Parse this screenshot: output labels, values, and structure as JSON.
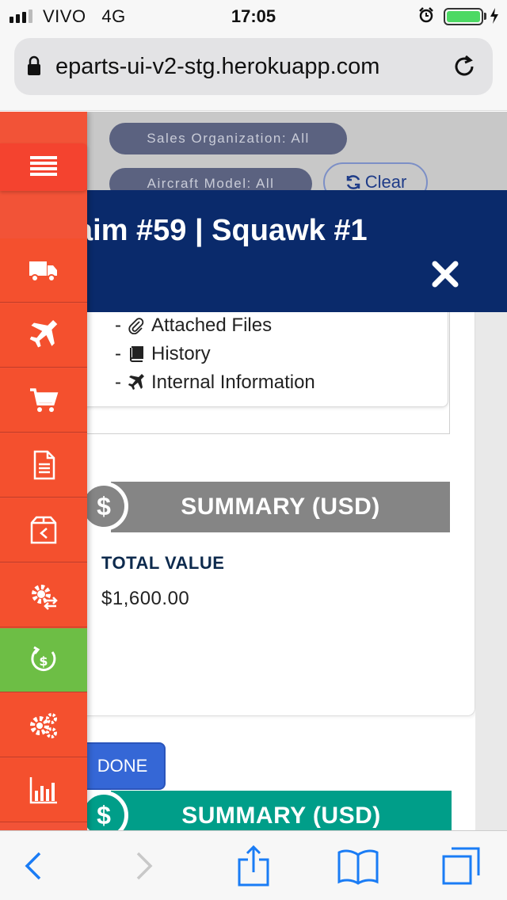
{
  "status_bar": {
    "carrier": "VIVO",
    "network": "4G",
    "time": "17:05",
    "battery_level": 1.0
  },
  "browser": {
    "url": "eparts-ui-v2-stg.herokuapp.com"
  },
  "filters": {
    "sales_org": "Sales Organization: All",
    "aircraft_model": "Aircraft Model: All",
    "clear_label": "Clear"
  },
  "modal": {
    "title": "aim #59 | Squawk #1"
  },
  "links": [
    {
      "prefix": "-",
      "icon": "paperclip-icon",
      "label": "Attached Files"
    },
    {
      "prefix": "-",
      "icon": "book-icon",
      "label": "History"
    },
    {
      "prefix": "-",
      "icon": "plane-icon",
      "label": "Internal Information"
    }
  ],
  "summary": {
    "heading": "SUMMARY (USD)",
    "dollar_symbol": "$",
    "total_label": "TOTAL VALUE",
    "total_value": "$1,600.00"
  },
  "summary_second": {
    "heading": "SUMMARY (USD)",
    "dollar_symbol": "$"
  },
  "done_label": "DONE",
  "sidenav": {
    "items": [
      "menu-icon",
      "truck-icon",
      "plane-icon",
      "cart-icon",
      "document-icon",
      "return-box-icon",
      "gear-exchange-icon",
      "dollar-cycle-icon",
      "gears-icon",
      "bar-chart-icon"
    ],
    "active_item": "dollar-cycle-icon",
    "colors": {
      "nav": "#f25337",
      "active": "#6dbe45"
    }
  },
  "colors": {
    "modal_header": "#0a2a6b",
    "summary_grey": "#858585",
    "summary_teal": "#009e89",
    "done_button": "#3567d6",
    "ios_blue": "#1a7cf5"
  }
}
